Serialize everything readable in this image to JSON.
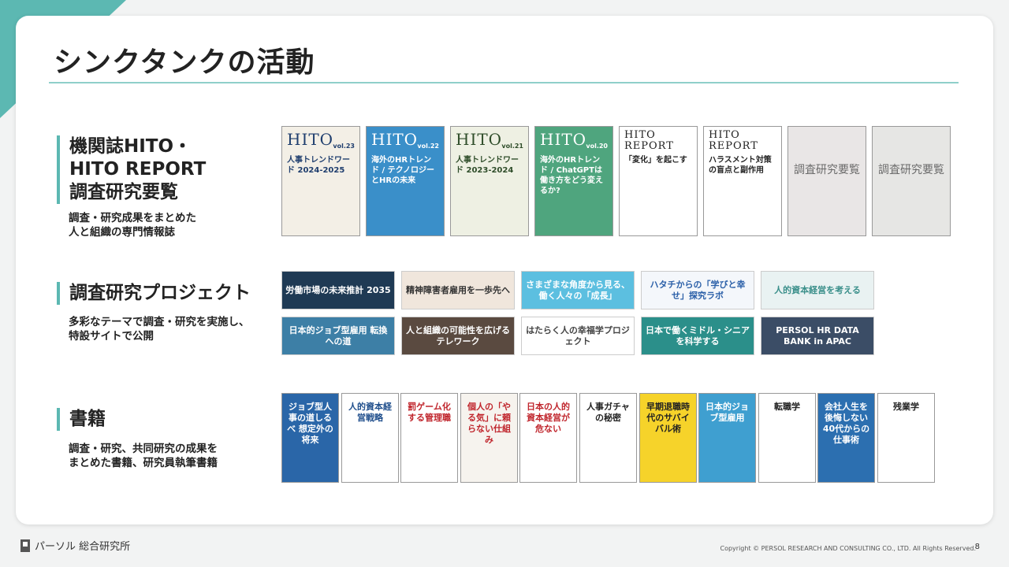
{
  "page_title": "シンクタンクの活動",
  "sections": [
    {
      "heading": "機関誌HITO・\nHITO REPORT\n調査研究要覧",
      "description": "調査・研究成果をまとめた\n人と組織の専門情報誌"
    },
    {
      "heading": "調査研究プロジェクト",
      "description": "多彩なテーマで調査・研究を実施し、\n特設サイトで公開"
    },
    {
      "heading": "書籍",
      "description": "調査・研究、共同研究の成果を\nまとめた書籍、研究員執筆書籍"
    }
  ],
  "magazines": [
    {
      "logo": "HITO",
      "vol": "vol.23",
      "text": "人事トレンドワード 2024-2025",
      "bg": "#f3efe6",
      "fg": "#1f3e6e"
    },
    {
      "logo": "HITO",
      "vol": "vol.22",
      "text": "海外のHRトレンド / テクノロジーとHRの未来",
      "bg": "#3a8fc9",
      "fg": "#ffffff"
    },
    {
      "logo": "HITO",
      "vol": "vol.21",
      "text": "人事トレンドワード 2023-2024",
      "bg": "#eef0e3",
      "fg": "#2f4d2a"
    },
    {
      "logo": "HITO",
      "vol": "vol.20",
      "text": "海外のHRトレンド / ChatGPTは働き方をどう変えるか?",
      "bg": "#4fa57e",
      "fg": "#ffffff"
    },
    {
      "logo": "HITO REPORT",
      "vol": "",
      "text": "「変化」を起こす",
      "bg": "#ffffff",
      "fg": "#222222"
    },
    {
      "logo": "HITO REPORT",
      "vol": "",
      "text": "ハラスメント対策の盲点と副作用",
      "bg": "#ffffff",
      "fg": "#222222"
    },
    {
      "logo": "",
      "vol": "",
      "text": "調査研究要覧",
      "bg": "#e9e6e6",
      "fg": "#6a6a6a"
    },
    {
      "logo": "",
      "vol": "",
      "text": "調査研究要覧",
      "bg": "#e6e6e4",
      "fg": "#6a6a6a"
    }
  ],
  "banners": [
    {
      "text": "労働市場の未来推計 2035",
      "bg": "#1f3a54",
      "fg": "#ffffff"
    },
    {
      "text": "精神障害者雇用を一歩先へ",
      "bg": "#f0e6dc",
      "fg": "#333333"
    },
    {
      "text": "さまざまな角度から見る、働く人々の「成長」",
      "bg": "#5cbfe0",
      "fg": "#ffffff"
    },
    {
      "text": "ハタチからの「学びと幸せ」探究ラボ",
      "bg": "#f4f7fb",
      "fg": "#2a5fa8"
    },
    {
      "text": "人的資本経営を考える",
      "bg": "#e9f2f2",
      "fg": "#3a8f8a"
    },
    {
      "text": "日本的ジョブ型雇用 転換への道",
      "bg": "#3d7fa6",
      "fg": "#ffffff"
    },
    {
      "text": "人と組織の可能性を広げるテレワーク",
      "bg": "#5a4a40",
      "fg": "#ffffff"
    },
    {
      "text": "はたらく人の幸福学プロジェクト",
      "bg": "#ffffff",
      "fg": "#444444"
    },
    {
      "text": "日本で働くミドル・シニアを科学する",
      "bg": "#2b8f8a",
      "fg": "#ffffff"
    },
    {
      "text": "PERSOL HR DATA BANK in APAC",
      "bg": "#3b4d66",
      "fg": "#ffffff"
    }
  ],
  "books": [
    {
      "text": "ジョブ型人事の道しるべ 想定外の将来",
      "bg": "#2a66a8",
      "fg": "#ffffff"
    },
    {
      "text": "人的資本経営戦略",
      "bg": "#ffffff",
      "fg": "#1f4e8c"
    },
    {
      "text": "罰ゲーム化する管理職",
      "bg": "#ffffff",
      "fg": "#c0262d"
    },
    {
      "text": "個人の「やる気」に頼らない仕組み",
      "bg": "#f6f3ee",
      "fg": "#c0262d"
    },
    {
      "text": "日本の人的資本経営が危ない",
      "bg": "#ffffff",
      "fg": "#c0262d"
    },
    {
      "text": "人事ガチャの秘密",
      "bg": "#ffffff",
      "fg": "#222222"
    },
    {
      "text": "早期退職時代のサバイバル術",
      "bg": "#f6d32a",
      "fg": "#222222"
    },
    {
      "text": "日本的ジョブ型雇用",
      "bg": "#3f9fd0",
      "fg": "#ffffff"
    },
    {
      "text": "転職学",
      "bg": "#ffffff",
      "fg": "#222222"
    },
    {
      "text": "会社人生を後悔しない40代からの仕事術",
      "bg": "#2c6fb0",
      "fg": "#ffffff"
    },
    {
      "text": "残業学",
      "bg": "#ffffff",
      "fg": "#222222"
    }
  ],
  "footer": {
    "company": "パーソル 総合研究所",
    "copyright": "Copyright © PERSOL RESEARCH AND CONSULTING CO., LTD. All Rights Reserved.",
    "page": "8"
  }
}
